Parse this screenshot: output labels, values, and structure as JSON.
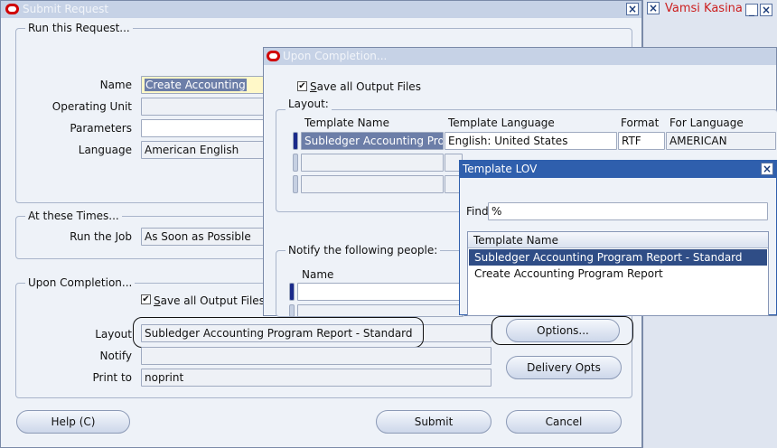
{
  "user": {
    "name": "Vamsi Kasina"
  },
  "submit_window": {
    "title": "Submit Request",
    "run_group": {
      "legend": "Run this Request...",
      "name_label": "Name",
      "name_value": "Create Accounting",
      "operating_unit_label": "Operating Unit",
      "parameters_label": "Parameters",
      "language_label": "Language",
      "language_value": "American English"
    },
    "times_group": {
      "legend": "At these Times...",
      "run_job_label": "Run the Job",
      "run_job_value": "As Soon as Possible"
    },
    "completion_group": {
      "legend": "Upon Completion...",
      "save_output_label": "Save all Output Files",
      "layout_label": "Layout",
      "layout_value": "Subledger Accounting Program Report - Standard",
      "notify_label": "Notify",
      "print_to_label": "Print to",
      "print_to_value": "noprint",
      "options_button": "Options...",
      "delivery_button": "Delivery Opts"
    },
    "help_button": "Help (C)",
    "submit_button": "Submit",
    "cancel_button": "Cancel"
  },
  "upon_window": {
    "title": "Upon Completion...",
    "save_output_label": "Save all Output Files",
    "layout_legend": "Layout:",
    "columns": [
      "Template Name",
      "Template Language",
      "Format",
      "For Language"
    ],
    "row1": {
      "template_name": "Subledger Accounting Program Report - Standard",
      "template_language": "English: United States",
      "format": "RTF",
      "for_language": "AMERICAN"
    },
    "notify_legend": "Notify the following people:",
    "name_column": "Name"
  },
  "lov_window": {
    "title": "Template LOV",
    "find_label": "Find",
    "find_value": "%",
    "column_header": "Template Name",
    "items": [
      "Subledger Accounting Program Report - Standard",
      "Create Accounting Program Report"
    ]
  }
}
